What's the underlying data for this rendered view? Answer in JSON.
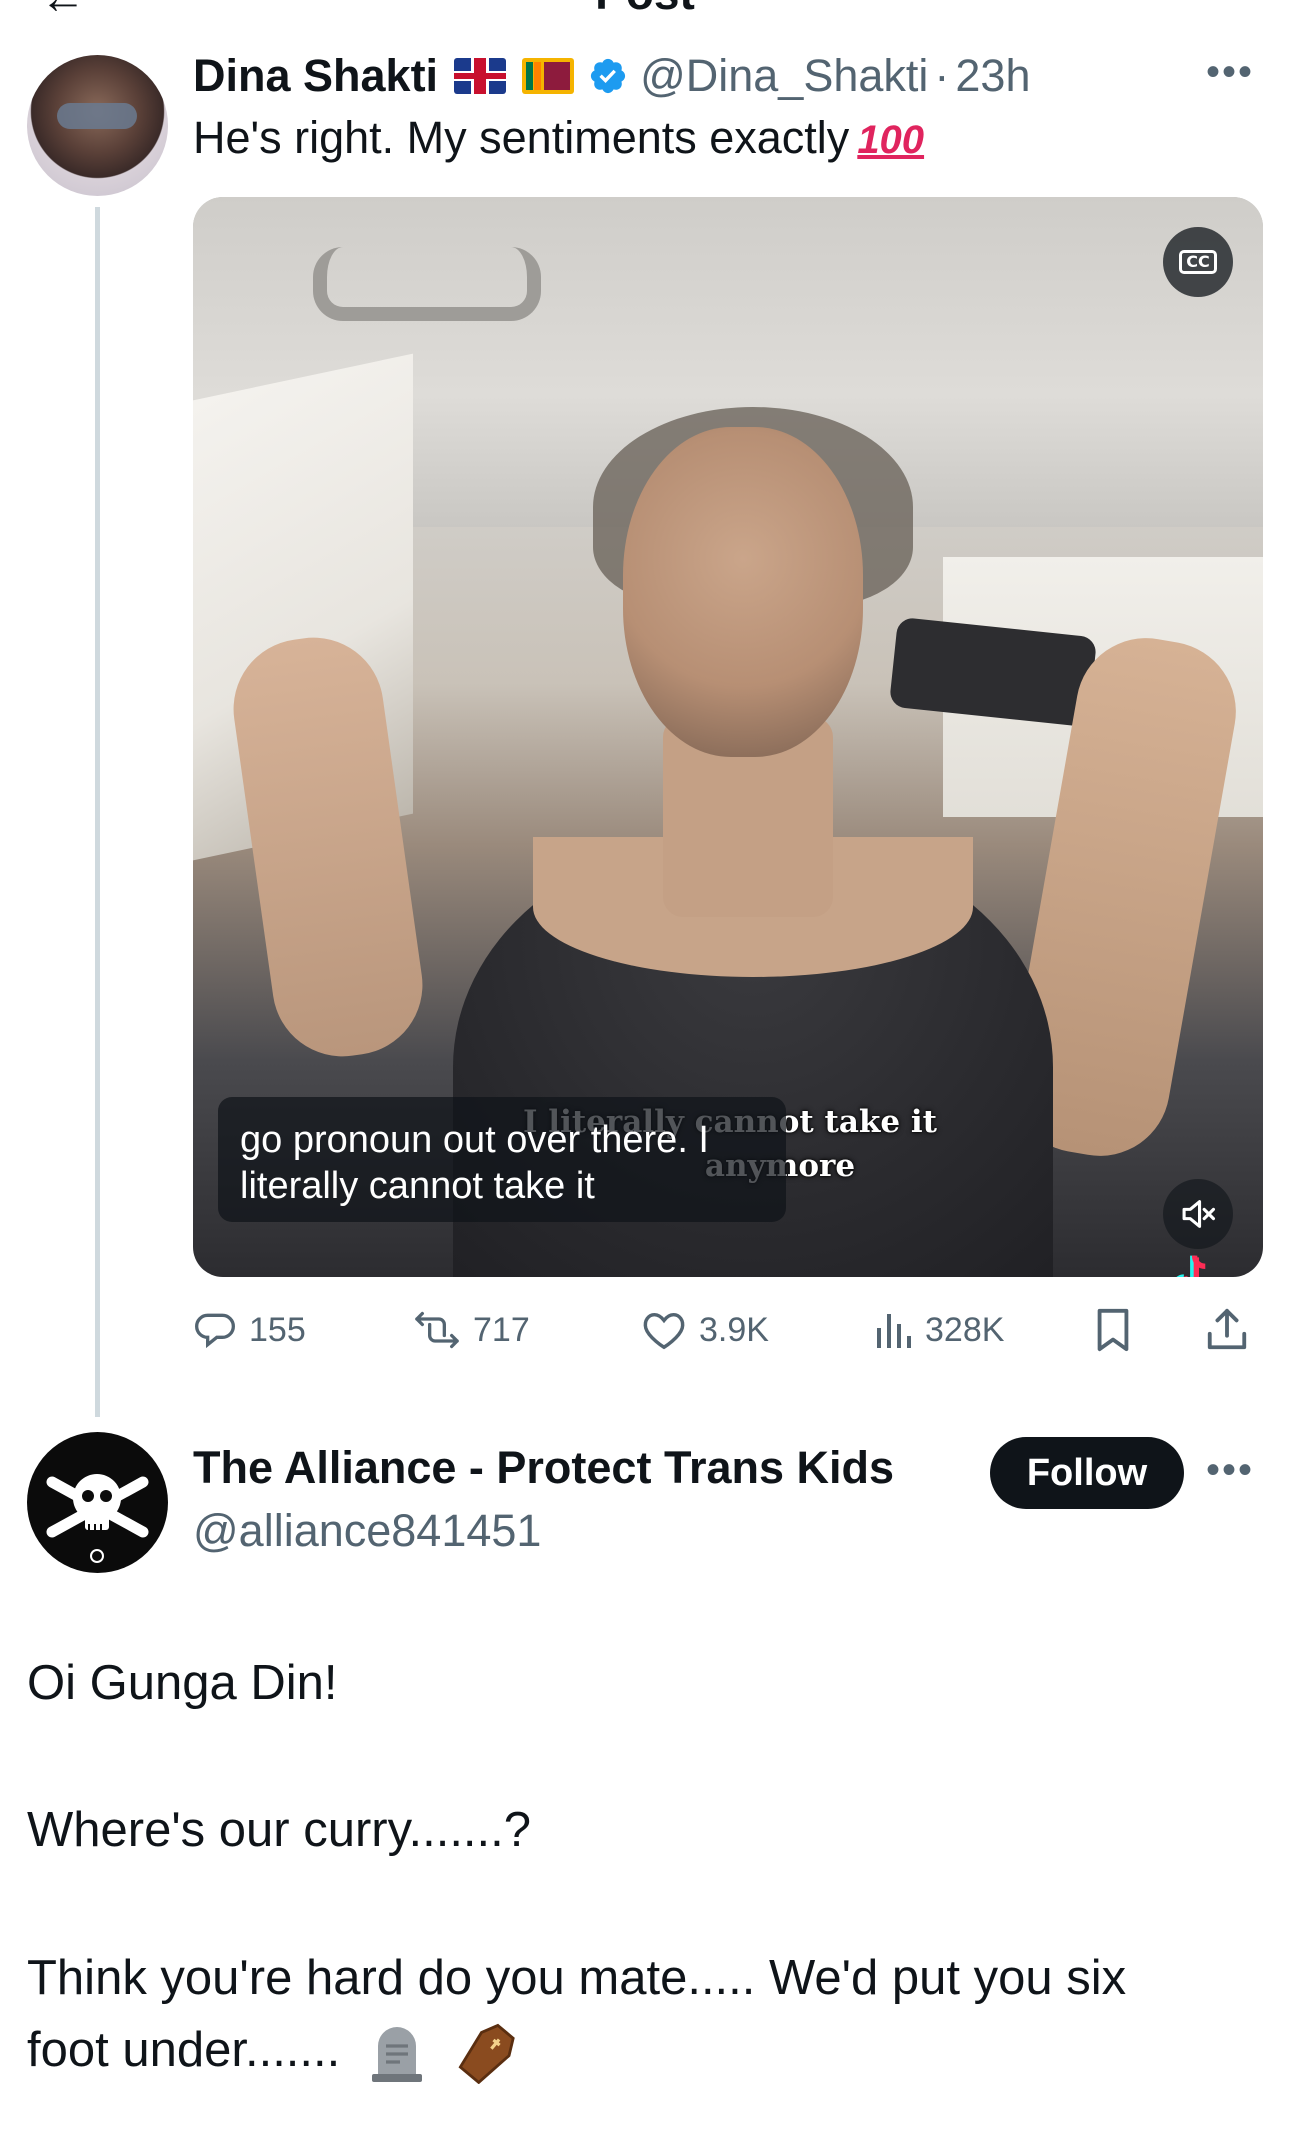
{
  "header": {
    "title": "Post"
  },
  "tweet": {
    "author_name": "Dina Shakti",
    "handle": "@Dina_Shakti",
    "time": "23h",
    "text": "He's right. My sentiments exactly",
    "emoji_label": "100",
    "video": {
      "cc_label": "CC",
      "caption_line1": "go pronoun out over there. I",
      "caption_line2": "literally cannot take it",
      "burned_sub_line1": "I literally cannot take it",
      "burned_sub_line2": "anymore"
    },
    "stats": {
      "replies": "155",
      "reposts": "717",
      "likes": "3.9K",
      "views": "328K"
    }
  },
  "reply": {
    "author_name": "The Alliance - Protect Trans Kids",
    "handle": "@alliance841451",
    "follow_label": "Follow",
    "line1": "Oi Gunga Din!",
    "line2": "Where's our curry.......?",
    "line3": "Think you're hard do you mate.....  We'd put you six",
    "line4": "foot under......."
  },
  "colors": {
    "text": "#0f1419",
    "secondary": "#536471",
    "verified": "#1d9bf0",
    "follow_bg": "#0f1419"
  }
}
